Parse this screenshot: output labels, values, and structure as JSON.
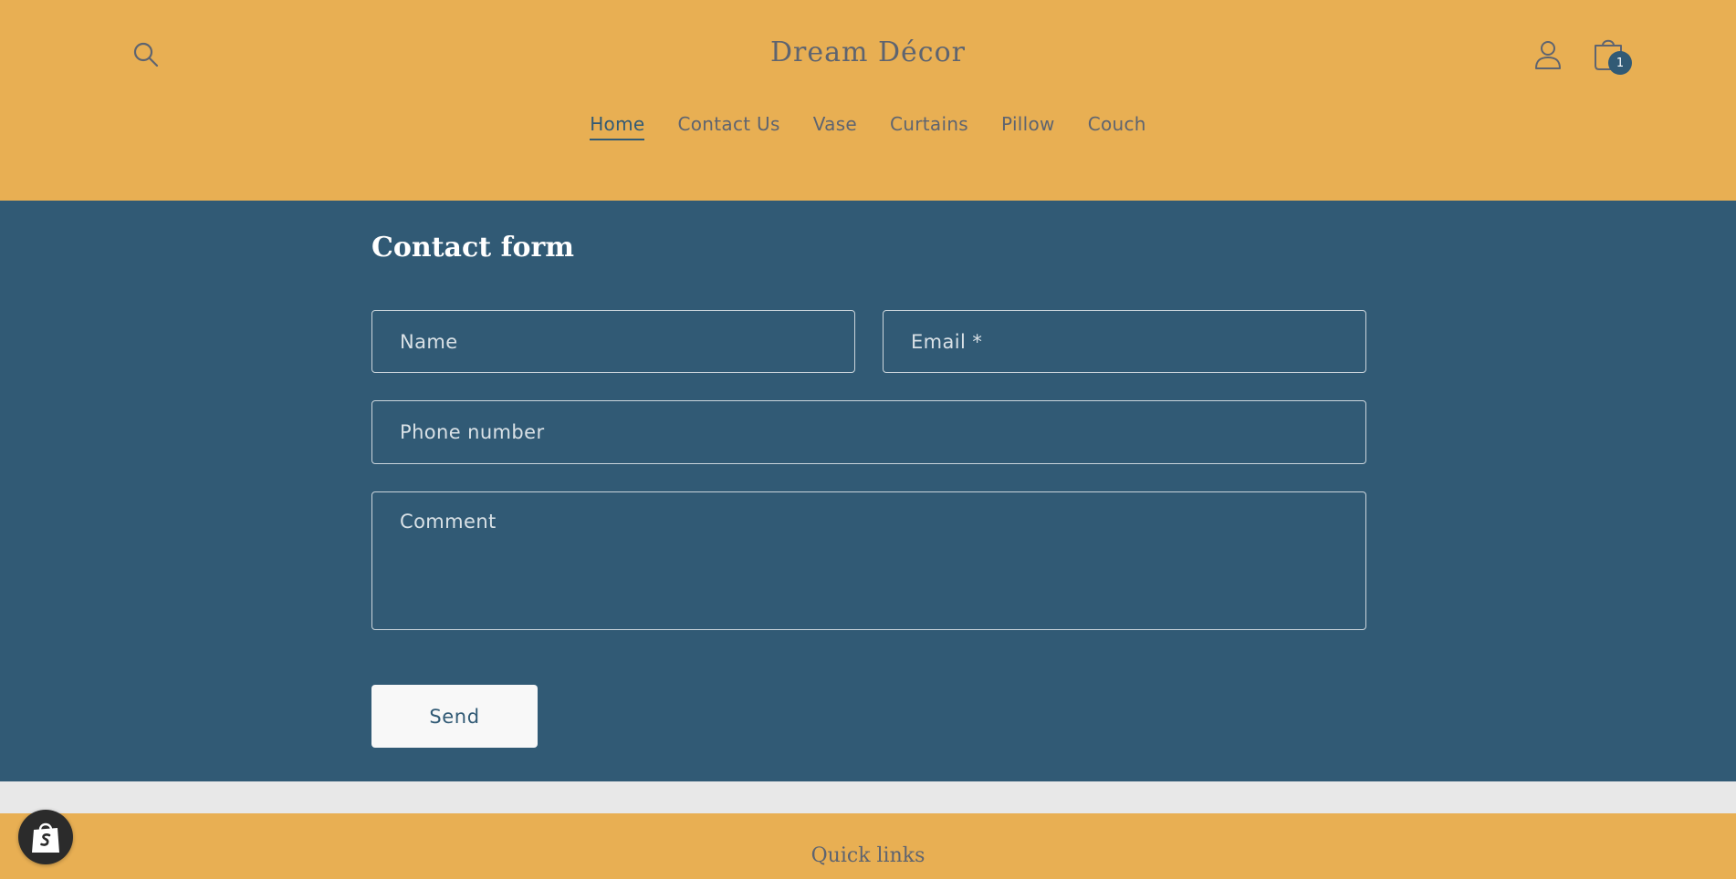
{
  "header": {
    "store_name": "Dream Décor",
    "cart_count": "1",
    "nav": [
      {
        "label": "Home",
        "active": true
      },
      {
        "label": "Contact Us"
      },
      {
        "label": "Vase"
      },
      {
        "label": "Curtains"
      },
      {
        "label": "Pillow"
      },
      {
        "label": "Couch"
      }
    ]
  },
  "contact_form": {
    "title": "Contact form",
    "name_placeholder": "Name",
    "email_placeholder": "Email *",
    "phone_placeholder": "Phone number",
    "comment_placeholder": "Comment",
    "send_label": "Send"
  },
  "footer": {
    "heading": "Quick links"
  },
  "icons": {
    "search": "search-icon",
    "account": "account-icon",
    "cart": "cart-icon",
    "shop_badge": "shopify-bag-icon"
  },
  "colors": {
    "header_bg": "#e8af53",
    "section_bg": "#315a75",
    "text_muted": "#5e6470",
    "button_bg": "#f8f8f8",
    "divider_band": "#e8e8e8"
  }
}
